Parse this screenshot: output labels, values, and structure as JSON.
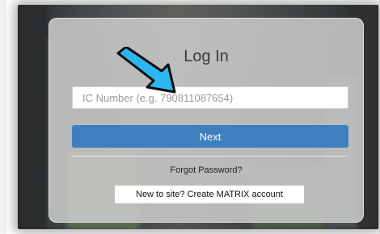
{
  "login": {
    "title": "Log In",
    "ic_placeholder": "IC Number (e.g. 790811087654)",
    "ic_value": "",
    "next_label": "Next",
    "forgot_label": "Forgot Password?",
    "create_label": "New to site? Create MATRIX account"
  },
  "colors": {
    "next_button": "#3d7fbf",
    "annotation_arrow": "#2bb6f0"
  },
  "icons": {
    "annotation": "arrow-pointer-icon"
  }
}
